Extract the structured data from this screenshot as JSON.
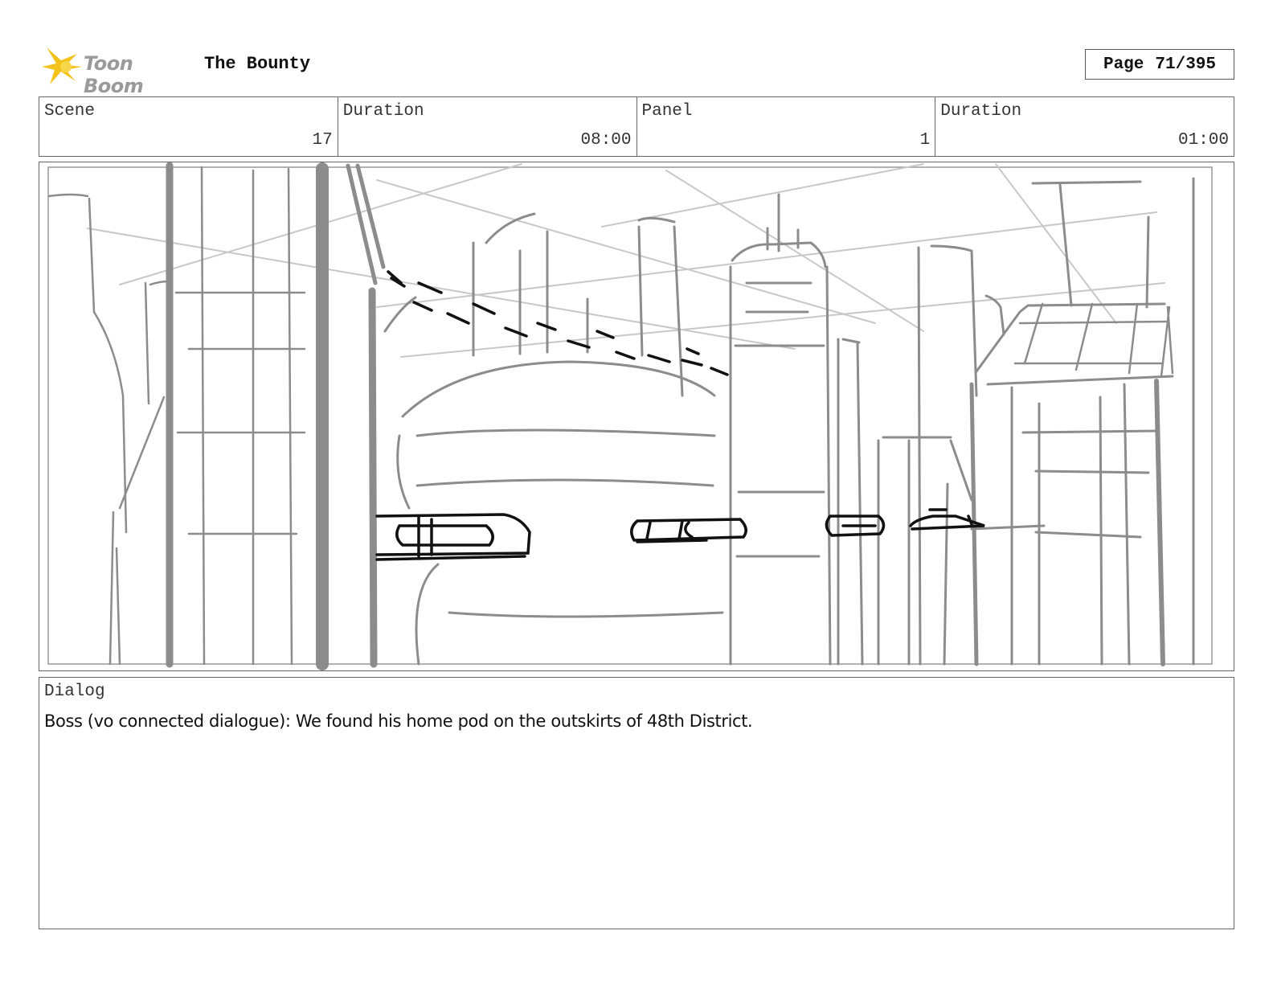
{
  "header": {
    "logo_text": "Toon Boom",
    "title": "The Bounty",
    "page_label": "Page",
    "page_number": "71/395"
  },
  "info": {
    "scene_label": "Scene",
    "scene_value": "17",
    "scene_duration_label": "Duration",
    "scene_duration_value": "08:00",
    "panel_label": "Panel",
    "panel_value": "1",
    "panel_duration_label": "Duration",
    "panel_duration_value": "01:00"
  },
  "dialog": {
    "label": "Dialog",
    "text": "Boss (vo connected dialogue): We found his home pod on the outskirts of 48th District."
  },
  "colors": {
    "logo_star": "#f4c21c",
    "sketch_gray": "#8c8c8c",
    "sketch_black": "#111111"
  }
}
